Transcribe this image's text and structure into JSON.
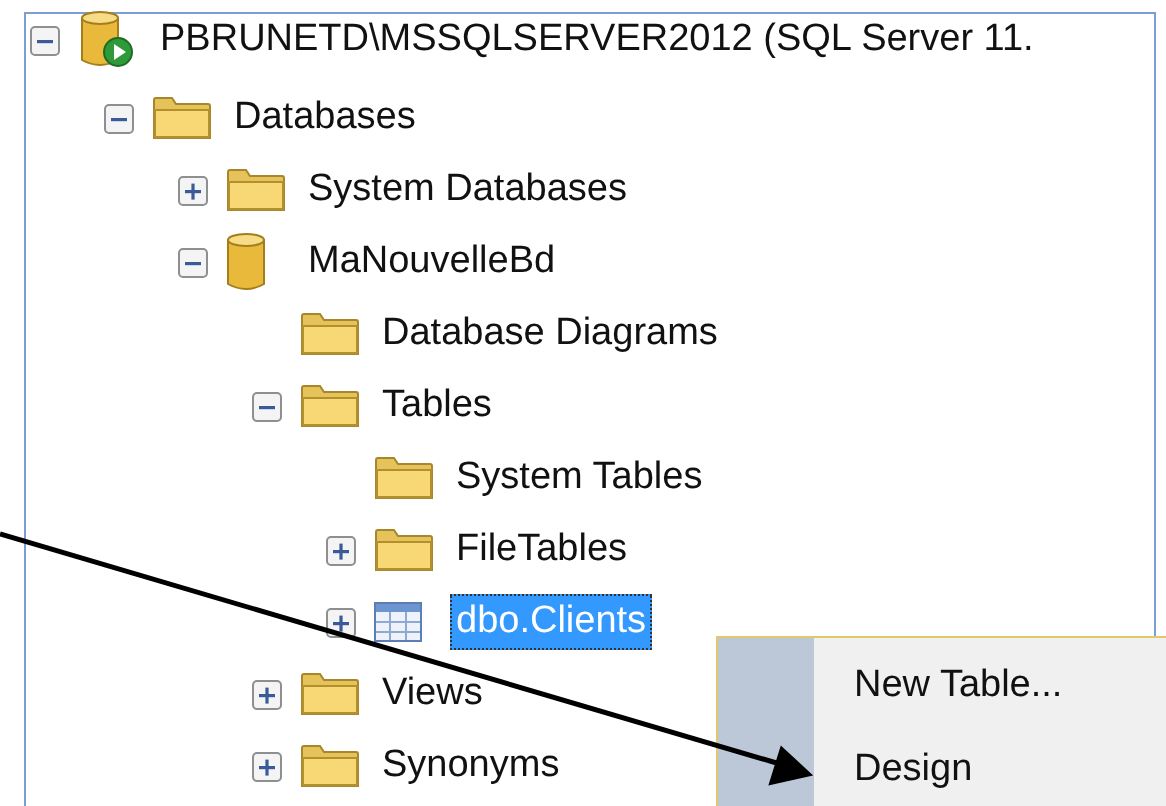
{
  "tree": [
    {
      "label": "PBRUNETD\\MSSQLSERVER2012 (SQL Server 11.",
      "kind": "server",
      "expanded": true,
      "selected": false,
      "children": [
        {
          "label": "Databases",
          "kind": "folder",
          "expanded": true,
          "selected": false,
          "children": [
            {
              "label": "System Databases",
              "kind": "folder",
              "expanded": false,
              "selected": false
            },
            {
              "label": "MaNouvelleBd",
              "kind": "database",
              "expanded": true,
              "selected": false,
              "children": [
                {
                  "label": "Database Diagrams",
                  "kind": "folder",
                  "selected": false
                },
                {
                  "label": "Tables",
                  "kind": "folder",
                  "expanded": true,
                  "selected": false,
                  "children": [
                    {
                      "label": "System Tables",
                      "kind": "folder",
                      "selected": false
                    },
                    {
                      "label": "FileTables",
                      "kind": "folder",
                      "expanded": false,
                      "selected": false
                    },
                    {
                      "label": "dbo.Clients",
                      "kind": "table",
                      "expanded": false,
                      "selected": true
                    }
                  ]
                },
                {
                  "label": "Views",
                  "kind": "folder",
                  "expanded": false,
                  "selected": false
                },
                {
                  "label": "Synonyms",
                  "kind": "folder",
                  "expanded": false,
                  "selected": false
                }
              ]
            }
          ]
        }
      ]
    }
  ],
  "context_menu": {
    "items": [
      {
        "label": "New Table..."
      },
      {
        "label": "Design"
      }
    ]
  }
}
